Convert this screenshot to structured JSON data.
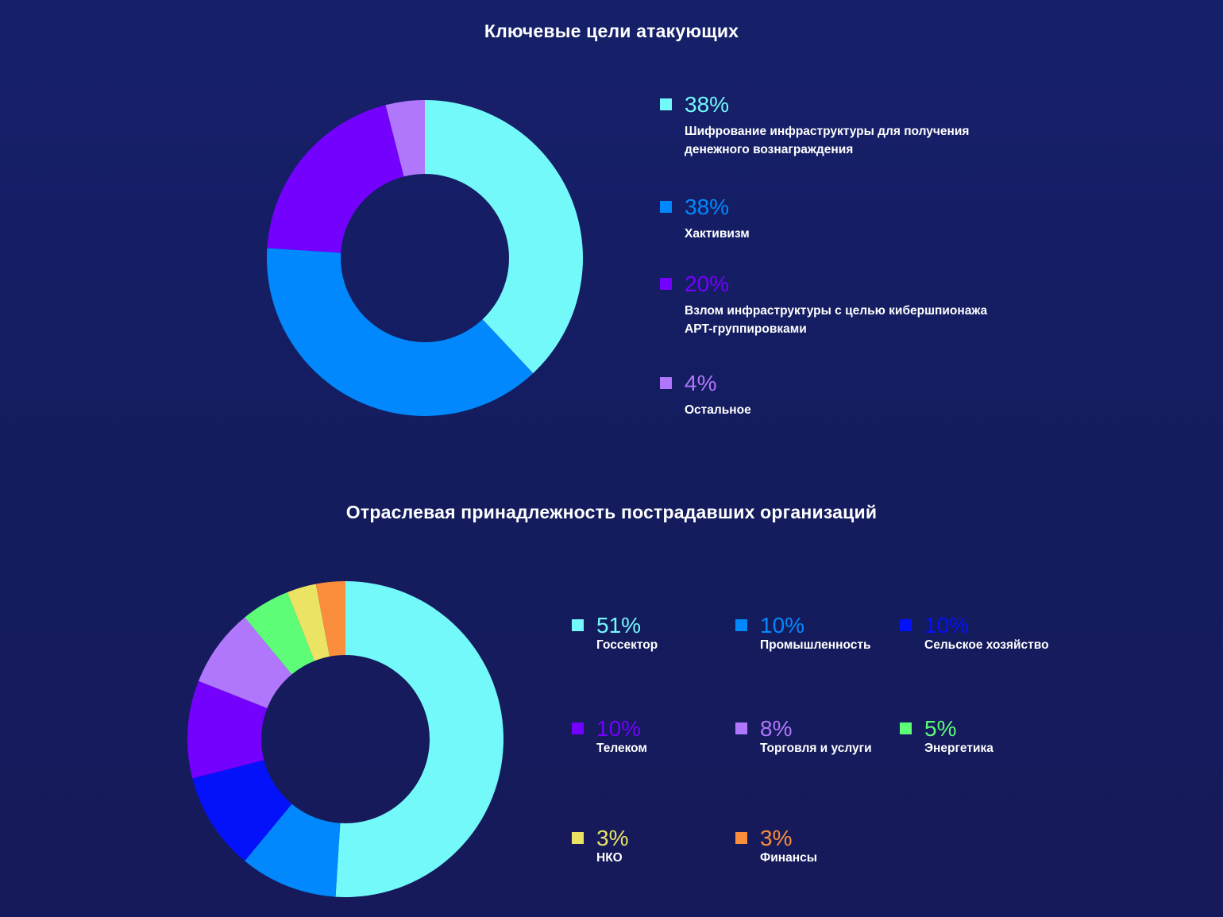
{
  "colors": {
    "background": "#151d62",
    "hole": "#151d62"
  },
  "chart_data": [
    {
      "type": "pie",
      "donut": true,
      "title": "Ключевые цели атакующих",
      "series": [
        {
          "name": "",
          "slices": [
            {
              "value": 38,
              "label": "38%",
              "text": [
                "Шифрование инфраструктуры для получения",
                "денежного вознаграждения"
              ],
              "color": "#74f9fb"
            },
            {
              "value": 38,
              "label": "38%",
              "text": [
                "Хактивизм"
              ],
              "color": "#0188fc"
            },
            {
              "value": 20,
              "label": "20%",
              "text": [
                "Взлом инфраструктуры с целью кибершпионажа",
                "APT-группировками"
              ],
              "color": "#7301fd"
            },
            {
              "value": 4,
              "label": "4%",
              "text": [
                "Остальное"
              ],
              "color": "#b077fc"
            }
          ]
        }
      ],
      "legend": "right"
    },
    {
      "type": "pie",
      "donut": true,
      "title": "Отраслевая принадлежность пострадавших организаций",
      "series": [
        {
          "name": "",
          "slices": [
            {
              "value": 51,
              "label": "51%",
              "text": [
                "Госсектор"
              ],
              "color": "#74f9fb"
            },
            {
              "value": 10,
              "label": "10%",
              "text": [
                "Промышленность"
              ],
              "color": "#0188fc"
            },
            {
              "value": 10,
              "label": "10%",
              "text": [
                "Сельское хозяйство"
              ],
              "color": "#0411fb"
            },
            {
              "value": 10,
              "label": "10%",
              "text": [
                "Телеком"
              ],
              "color": "#7301fd"
            },
            {
              "value": 8,
              "label": "8%",
              "text": [
                "Торговля и услуги"
              ],
              "color": "#b077fc"
            },
            {
              "value": 5,
              "label": "5%",
              "text": [
                "Энергетика"
              ],
              "color": "#5dfd78"
            },
            {
              "value": 3,
              "label": "3%",
              "text": [
                "НКО"
              ],
              "color": "#ebe364"
            },
            {
              "value": 3,
              "label": "3%",
              "text": [
                "Финансы"
              ],
              "color": "#fa8e3c"
            }
          ]
        }
      ],
      "legend": "right"
    }
  ]
}
